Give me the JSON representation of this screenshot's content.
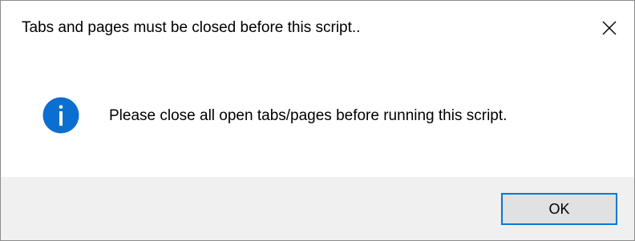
{
  "dialog": {
    "title": "Tabs and pages must be closed before this script..",
    "message": "Please close all open tabs/pages before running this script.",
    "icon": "info-icon",
    "close_icon": "close-icon",
    "ok_label": "OK"
  },
  "colors": {
    "icon_blue": "#0a6fd1",
    "button_border": "#0078d7",
    "button_fill": "#e1e1e1",
    "footer_bg": "#f0f0f0"
  }
}
